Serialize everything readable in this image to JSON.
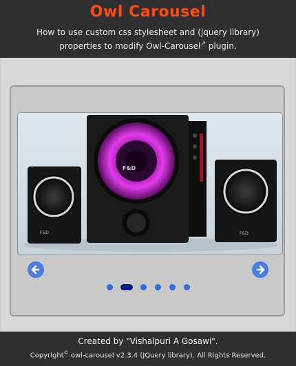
{
  "header": {
    "title": "Owl Carousel",
    "subtitle_prefix": "How to use custom css stylesheet and (jquery library) properties to modify Owl-Carousel",
    "subtitle_suffix": "plugin.",
    "external_icon": "external-link-icon"
  },
  "carousel": {
    "slide_image": "speaker-system-photo",
    "brand": "F&D",
    "prev_icon": "arrow-left-icon",
    "next_icon": "arrow-right-icon",
    "dot_count": 6,
    "active_dot": 2
  },
  "footer": {
    "credit": "Created by \"Vishalpuri A Gosawi\".",
    "copyright_word": "Copyright",
    "copyright_mark": "©",
    "copyright_rest": " owl-carousel v2.3.4 (JQuery library). All Rights Reserved."
  },
  "colors": {
    "title": "#ff4a12",
    "header_bg": "#2f2f2f",
    "nav_button": "#4b7ce0",
    "dot": "#2f6be5",
    "dot_active": "#071a8a",
    "speaker_glow": "#d229d9"
  }
}
